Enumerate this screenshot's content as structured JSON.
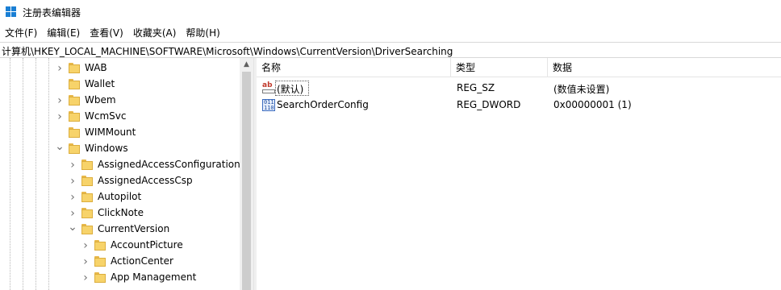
{
  "window": {
    "title": "注册表编辑器"
  },
  "menu": [
    {
      "label": "文件(F)"
    },
    {
      "label": "编辑(E)"
    },
    {
      "label": "查看(V)"
    },
    {
      "label": "收藏夹(A)"
    },
    {
      "label": "帮助(H)"
    }
  ],
  "address": {
    "path": "计算机\\HKEY_LOCAL_MACHINE\\SOFTWARE\\Microsoft\\Windows\\CurrentVersion\\DriverSearching"
  },
  "tree": {
    "items": [
      {
        "label": "WAB",
        "expander": "collapsed",
        "level": 0
      },
      {
        "label": "Wallet",
        "expander": "none",
        "level": 0
      },
      {
        "label": "Wbem",
        "expander": "collapsed",
        "level": 0
      },
      {
        "label": "WcmSvc",
        "expander": "collapsed",
        "level": 0
      },
      {
        "label": "WIMMount",
        "expander": "none",
        "level": 0
      },
      {
        "label": "Windows",
        "expander": "expanded",
        "level": 0
      },
      {
        "label": "AssignedAccessConfiguration",
        "expander": "collapsed",
        "level": 1
      },
      {
        "label": "AssignedAccessCsp",
        "expander": "collapsed",
        "level": 1
      },
      {
        "label": "Autopilot",
        "expander": "collapsed",
        "level": 1
      },
      {
        "label": "ClickNote",
        "expander": "collapsed",
        "level": 1
      },
      {
        "label": "CurrentVersion",
        "expander": "expanded",
        "level": 1
      },
      {
        "label": "AccountPicture",
        "expander": "collapsed",
        "level": 2
      },
      {
        "label": "ActionCenter",
        "expander": "collapsed",
        "level": 2
      },
      {
        "label": "App Management",
        "expander": "collapsed",
        "level": 2
      }
    ]
  },
  "list": {
    "columns": {
      "name": "名称",
      "type": "类型",
      "data": "数据"
    },
    "rows": [
      {
        "icon": "string-value-icon",
        "icon_text": "ab",
        "name": "(默认)",
        "type": "REG_SZ",
        "data": "(数值未设置)"
      },
      {
        "icon": "dword-value-icon",
        "icon_text": "011\n110",
        "name": "SearchOrderConfig",
        "type": "REG_DWORD",
        "data": "0x00000001 (1)"
      }
    ]
  },
  "colors": {
    "accent": "#1a7fd4",
    "folder": "#f7d36a"
  }
}
